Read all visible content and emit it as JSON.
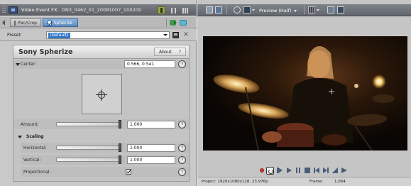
{
  "fx_window": {
    "title": "Video Event FX:",
    "clip_name": "DN3_0462_01_20081007_100200",
    "chain": {
      "items": [
        {
          "label": "Pan/Crop"
        },
        {
          "label": "Spherize"
        }
      ]
    },
    "preset": {
      "label": "Preset:",
      "value": "(Default)"
    },
    "plugin": {
      "name": "Sony Spherize",
      "about_label": "About",
      "about_dots": "?",
      "center": {
        "label": "Center:",
        "value": "0.566, 0.541"
      },
      "amount": {
        "label": "Amount:",
        "value": "1.000",
        "level": 1.0
      },
      "scaling": {
        "label": "Scaling",
        "horizontal": {
          "label": "Horizontal:",
          "value": "1.000",
          "level": 1.0
        },
        "vertical": {
          "label": "Vertical:",
          "value": "1.000",
          "level": 1.0
        },
        "proportional": {
          "label": "Proportional:",
          "checked": true
        }
      }
    }
  },
  "preview_window": {
    "quality": "Preview (Half)",
    "status": {
      "project": "Project:  1920x1080x128, 23.976p",
      "frame_label": "Frame:",
      "frame_value": "1,064"
    }
  },
  "colors": {
    "selection_blue": "#3178c6",
    "title_bar": "#6a6d74",
    "panel_grey": "#c4c4c4"
  }
}
